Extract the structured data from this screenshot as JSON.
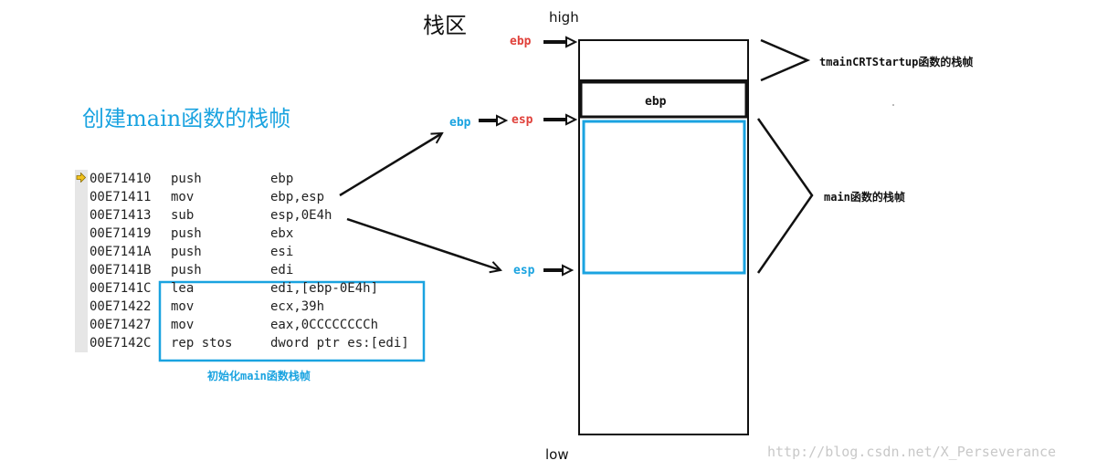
{
  "title": "栈区",
  "high_label": "high",
  "low_label": "low",
  "main_title": "创建main函数的栈帧",
  "pointers": {
    "ebp_top": "ebp",
    "ebp_mid": "ebp",
    "esp_mid": "esp",
    "esp_low": "esp"
  },
  "stack_box_label": "ebp",
  "side_labels": {
    "tmain": "tmainCRTStartup函数的栈帧",
    "main": "main函数的栈帧"
  },
  "code_lines": [
    {
      "addr": "00E71410",
      "op": "push",
      "arg": "ebp"
    },
    {
      "addr": "00E71411",
      "op": "mov",
      "arg": "ebp,esp"
    },
    {
      "addr": "00E71413",
      "op": "sub",
      "arg": "esp,0E4h"
    },
    {
      "addr": "00E71419",
      "op": "push",
      "arg": "ebx"
    },
    {
      "addr": "00E7141A",
      "op": "push",
      "arg": "esi"
    },
    {
      "addr": "00E7141B",
      "op": "push",
      "arg": "edi"
    },
    {
      "addr": "00E7141C",
      "op": "lea",
      "arg": "edi,[ebp-0E4h]"
    },
    {
      "addr": "00E71422",
      "op": "mov",
      "arg": "ecx,39h"
    },
    {
      "addr": "00E71427",
      "op": "mov",
      "arg": "eax,0CCCCCCCCh"
    },
    {
      "addr": "00E7142C",
      "op": "rep stos",
      "arg": "dword ptr es:[edi]"
    }
  ],
  "init_label": "初始化main函数栈帧",
  "watermark": "http://blog.csdn.net/X_Perseverance",
  "colors": {
    "red": "#e0403a",
    "blue": "#1aa3e0",
    "black": "#111111"
  },
  "icons": {
    "current_instruction": "yellow-arrow-icon"
  }
}
